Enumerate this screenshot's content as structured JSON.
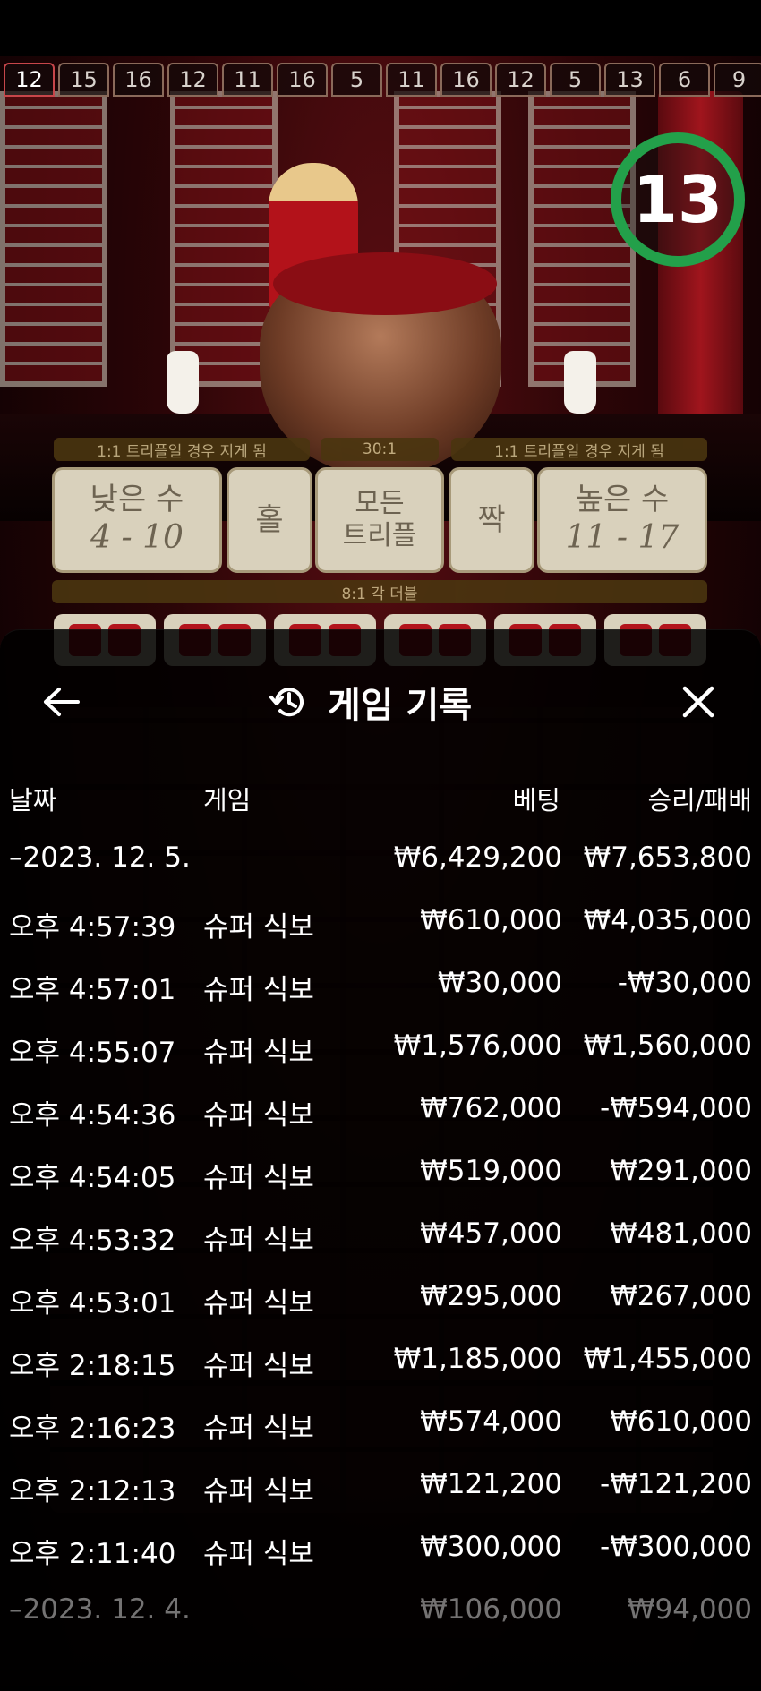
{
  "game_view": {
    "history_numbers": [
      "12",
      "15",
      "16",
      "12",
      "11",
      "16",
      "5",
      "11",
      "16",
      "12",
      "5",
      "13",
      "6",
      "9"
    ],
    "timer": "13",
    "strips": {
      "left_payout": "1:1 트리플일 경우 지게 됨",
      "center_payout": "30:1",
      "right_payout": "1:1 트리플일 경우 지게 됨",
      "double_payout": "8:1 각 더블"
    },
    "bets": {
      "small_label": "낮은 수",
      "small_range": "4 - 10",
      "odd_label": "홀",
      "any_triple_line1": "모든",
      "any_triple_line2": "트리플",
      "even_label": "짝",
      "big_label": "높은 수",
      "big_range": "11 - 17"
    }
  },
  "history_panel": {
    "title": "게임 기록",
    "columns": {
      "date": "날짜",
      "game": "게임",
      "bet": "베팅",
      "win_loss": "승리/패배"
    },
    "rows": [
      {
        "type": "date",
        "time": "–2023. 12. 5.",
        "game": "",
        "bet": "₩6,429,200",
        "result": "₩7,653,800"
      },
      {
        "type": "entry",
        "time": "오후 4:57:39",
        "game": "슈퍼 식보",
        "bet": "₩610,000",
        "result": "₩4,035,000"
      },
      {
        "type": "entry",
        "time": "오후 4:57:01",
        "game": "슈퍼 식보",
        "bet": "₩30,000",
        "result": "-₩30,000"
      },
      {
        "type": "entry",
        "time": "오후 4:55:07",
        "game": "슈퍼 식보",
        "bet": "₩1,576,000",
        "result": "₩1,560,000"
      },
      {
        "type": "entry",
        "time": "오후 4:54:36",
        "game": "슈퍼 식보",
        "bet": "₩762,000",
        "result": "-₩594,000"
      },
      {
        "type": "entry",
        "time": "오후 4:54:05",
        "game": "슈퍼 식보",
        "bet": "₩519,000",
        "result": "₩291,000"
      },
      {
        "type": "entry",
        "time": "오후 4:53:32",
        "game": "슈퍼 식보",
        "bet": "₩457,000",
        "result": "₩481,000"
      },
      {
        "type": "entry",
        "time": "오후 4:53:01",
        "game": "슈퍼 식보",
        "bet": "₩295,000",
        "result": "₩267,000"
      },
      {
        "type": "entry",
        "time": "오후 2:18:15",
        "game": "슈퍼 식보",
        "bet": "₩1,185,000",
        "result": "₩1,455,000"
      },
      {
        "type": "entry",
        "time": "오후 2:16:23",
        "game": "슈퍼 식보",
        "bet": "₩574,000",
        "result": "₩610,000"
      },
      {
        "type": "entry",
        "time": "오후 2:12:13",
        "game": "슈퍼 식보",
        "bet": "₩121,200",
        "result": "-₩121,200"
      },
      {
        "type": "entry",
        "time": "오후 2:11:40",
        "game": "슈퍼 식보",
        "bet": "₩300,000",
        "result": "-₩300,000"
      },
      {
        "type": "date",
        "time": "–2023. 12. 4.",
        "game": "",
        "bet": "₩106,000",
        "result": "₩94,000"
      }
    ]
  },
  "icons": {
    "back": "arrow-left-icon",
    "history": "history-icon",
    "close": "close-icon"
  }
}
